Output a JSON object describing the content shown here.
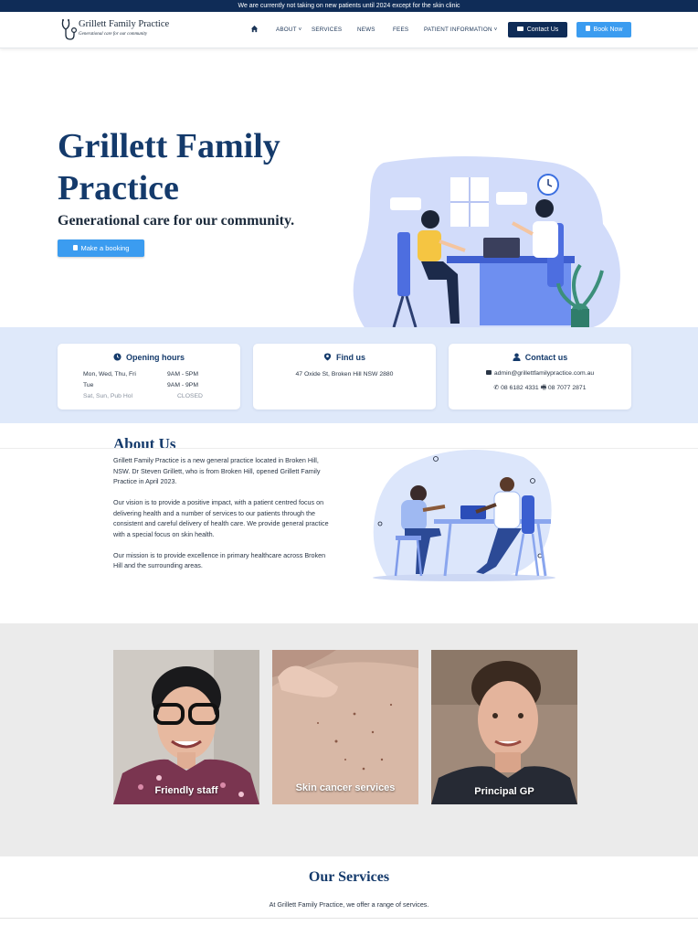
{
  "announcement": "We are currently not taking on new patients until 2024 except for the skin clinic",
  "logo": {
    "name": "Grillett Family Practice",
    "tagline": "Generational care for our community"
  },
  "nav": {
    "home_icon": "home-icon",
    "items": [
      "ABOUT",
      "SERVICES",
      "NEWS",
      "FEES",
      "PATIENT INFORMATION"
    ],
    "contact_label": "Contact Us",
    "book_label": "Book Now"
  },
  "hero": {
    "title": "Grillett Family Practice",
    "subtitle": "Generational care for our community.",
    "button_label": "Make a booking"
  },
  "cards": {
    "hours": {
      "title": "Opening hours",
      "rows": [
        {
          "days": "Mon, Wed, Thu, Fri",
          "time": "9AM - 5PM"
        },
        {
          "days": "Tue",
          "time": "9AM - 9PM"
        },
        {
          "days": "Sat, Sun, Pub Hol",
          "time": "CLOSED"
        }
      ]
    },
    "find": {
      "title": "Find us",
      "address": "47 Oxide St, Broken Hill NSW 2880"
    },
    "contact": {
      "title": "Contact us",
      "email": "admin@grillettfamilypractice.com.au",
      "phone": "08 6182 4331",
      "fax": "08 7077 2871"
    }
  },
  "about": {
    "title": "About Us",
    "p1": "Grillett Family Practice is a new general practice located in Broken Hill, NSW.  Dr Steven Grillett, who is from Broken Hill, opened Grillett Family Practice in April 2023.",
    "p2": "Our vision is to provide a positive impact, with a patient centred focus on delivering health and a number of services to our patients through the consistent and careful delivery of health care. We provide general practice with a special focus on skin health.",
    "p3": "Our mission is to provide excellence in primary healthcare across Broken Hill and the surrounding areas."
  },
  "gallery": [
    {
      "label": "Friendly staff"
    },
    {
      "label": "Skin cancer services"
    },
    {
      "label": "Principal GP"
    }
  ],
  "services": {
    "title": "Our Services",
    "intro": "At Grillett Family Practice, we offer a range of services."
  },
  "colors": {
    "navy": "#0f2c57",
    "heading_blue": "#143a6b",
    "accent_blue": "#3b9cf0",
    "band_blue": "#dfe9fa"
  }
}
